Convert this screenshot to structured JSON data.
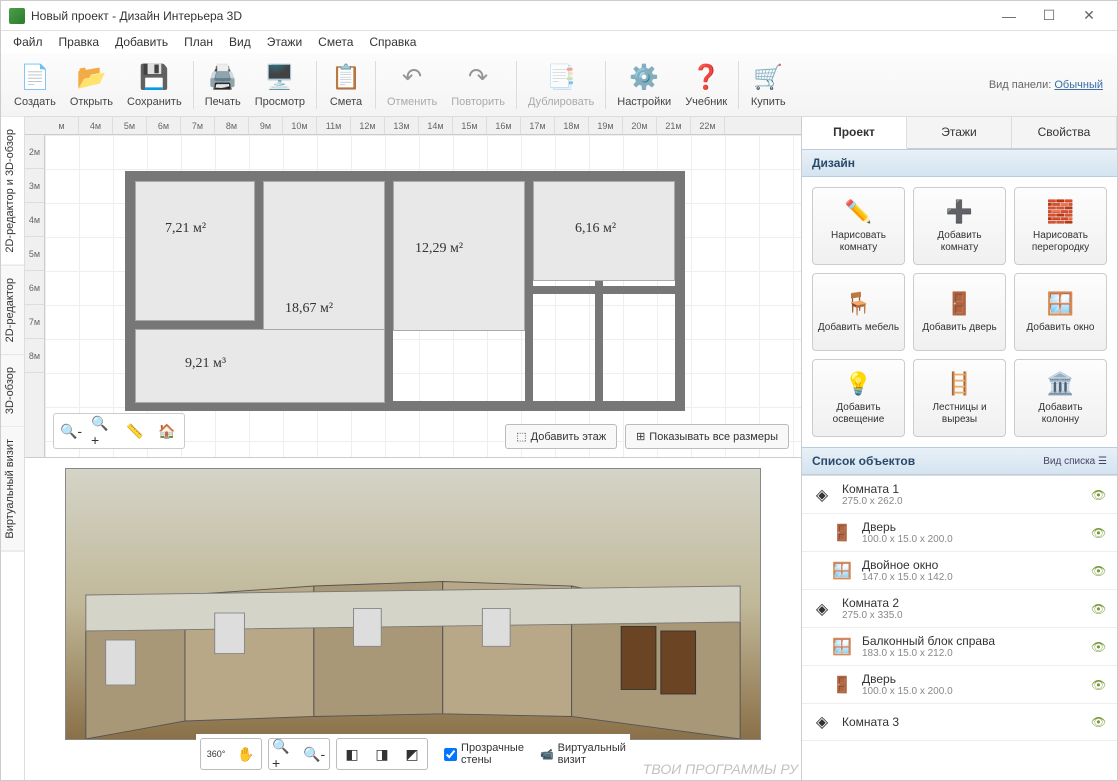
{
  "window": {
    "title": "Новый проект - Дизайн Интерьера 3D"
  },
  "menu": [
    "Файл",
    "Правка",
    "Добавить",
    "План",
    "Вид",
    "Этажи",
    "Смета",
    "Справка"
  ],
  "panelMode": {
    "label": "Вид панели:",
    "value": "Обычный"
  },
  "toolbar": [
    {
      "key": "create",
      "label": "Создать",
      "icon": "📄"
    },
    {
      "key": "open",
      "label": "Открыть",
      "icon": "📂"
    },
    {
      "key": "save",
      "label": "Сохранить",
      "icon": "💾"
    },
    {
      "sep": true
    },
    {
      "key": "print",
      "label": "Печать",
      "icon": "🖨️"
    },
    {
      "key": "preview",
      "label": "Просмотр",
      "icon": "🖥️"
    },
    {
      "sep": true
    },
    {
      "key": "estimate",
      "label": "Смета",
      "icon": "📋"
    },
    {
      "sep": true
    },
    {
      "key": "undo",
      "label": "Отменить",
      "icon": "↶",
      "disabled": true
    },
    {
      "key": "redo",
      "label": "Повторить",
      "icon": "↷",
      "disabled": true
    },
    {
      "sep": true
    },
    {
      "key": "duplicate",
      "label": "Дублировать",
      "icon": "📑",
      "disabled": true
    },
    {
      "sep": true
    },
    {
      "key": "settings",
      "label": "Настройки",
      "icon": "⚙️"
    },
    {
      "key": "help",
      "label": "Учебник",
      "icon": "❓"
    },
    {
      "sep": true
    },
    {
      "key": "buy",
      "label": "Купить",
      "icon": "🛒"
    }
  ],
  "sideTabs": [
    "2D-редактор и 3D-обзор",
    "2D-редактор",
    "3D-обзор",
    "Виртуальный визит"
  ],
  "rulerH": [
    "м",
    "4м",
    "5м",
    "6м",
    "7м",
    "8м",
    "9м",
    "10м",
    "11м",
    "12м",
    "13м",
    "14м",
    "15м",
    "16м",
    "17м",
    "18м",
    "19м",
    "20м",
    "21м",
    "22м"
  ],
  "rulerV": [
    "2м",
    "3м",
    "4м",
    "5м",
    "6м",
    "7м",
    "8м"
  ],
  "rooms": {
    "r1": "7,21 м²",
    "r2": "18,67 м²",
    "r3": "12,29 м²",
    "r4": "6,16 м²",
    "r5": "9,21 м³"
  },
  "planActions": {
    "addFloor": "Добавить этаж",
    "showDims": "Показывать все размеры"
  },
  "view3d": {
    "transparentWalls": "Прозрачные стены",
    "record": "Виртуальный визит"
  },
  "rightTabs": [
    "Проект",
    "Этажи",
    "Свойства"
  ],
  "sections": {
    "design": "Дизайн",
    "objects": "Список объектов",
    "listMode": "Вид списка"
  },
  "designButtons": [
    {
      "label": "Нарисовать комнату",
      "icon": "✏️"
    },
    {
      "label": "Добавить комнату",
      "icon": "➕"
    },
    {
      "label": "Нарисовать перегородку",
      "icon": "🧱"
    },
    {
      "label": "Добавить мебель",
      "icon": "🪑"
    },
    {
      "label": "Добавить дверь",
      "icon": "🚪"
    },
    {
      "label": "Добавить окно",
      "icon": "🪟"
    },
    {
      "label": "Добавить освещение",
      "icon": "💡"
    },
    {
      "label": "Лестницы и вырезы",
      "icon": "🪜"
    },
    {
      "label": "Добавить колонну",
      "icon": "🏛️"
    }
  ],
  "objects": [
    {
      "name": "Комната 1",
      "dim": "275.0 x 262.0",
      "icon": "◈",
      "level": 0
    },
    {
      "name": "Дверь",
      "dim": "100.0 x 15.0 x 200.0",
      "icon": "🚪",
      "level": 1
    },
    {
      "name": "Двойное окно",
      "dim": "147.0 x 15.0 x 142.0",
      "icon": "🪟",
      "level": 1
    },
    {
      "name": "Комната 2",
      "dim": "275.0 x 335.0",
      "icon": "◈",
      "level": 0
    },
    {
      "name": "Балконный блок справа",
      "dim": "183.0 x 15.0 x 212.0",
      "icon": "🪟",
      "level": 1
    },
    {
      "name": "Дверь",
      "dim": "100.0 x 15.0 x 200.0",
      "icon": "🚪",
      "level": 1
    },
    {
      "name": "Комната 3",
      "dim": "",
      "icon": "◈",
      "level": 0
    }
  ],
  "watermark": "ТВОИ ПРОГРАММЫ РУ"
}
